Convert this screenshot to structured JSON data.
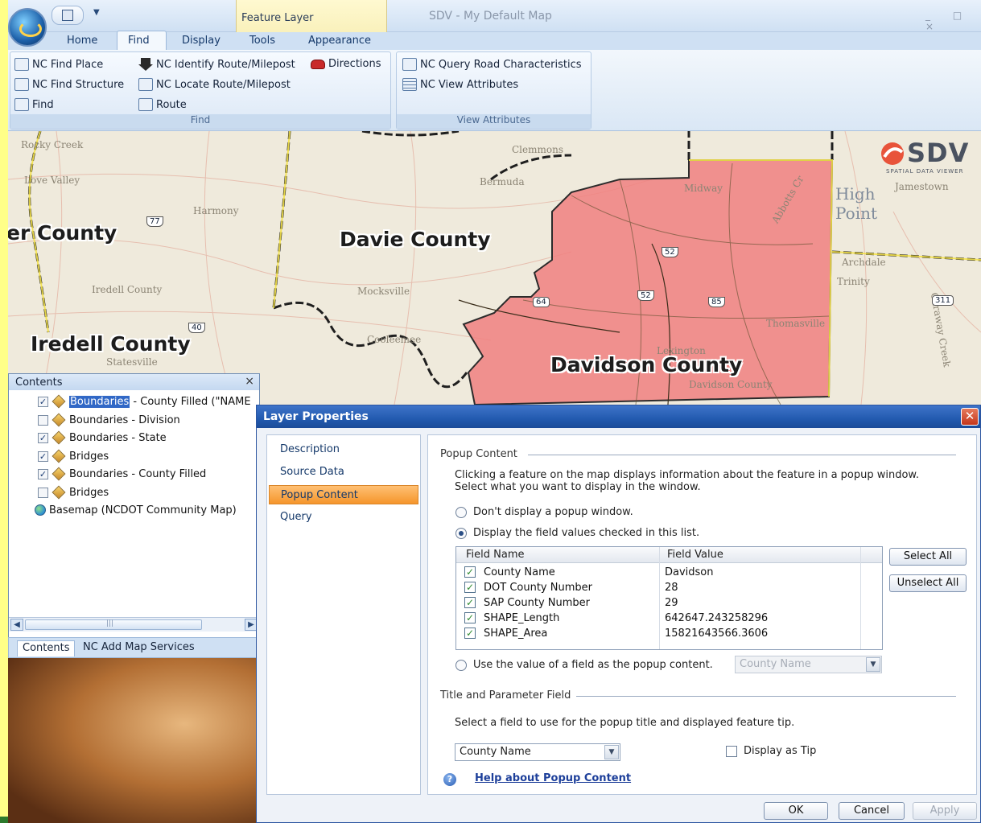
{
  "window": {
    "title": "SDV - My Default Map",
    "contextual_tab_group": "Feature Layer",
    "controls": "_ □ ×"
  },
  "ribbon": {
    "tabs": [
      "Home",
      "Find",
      "Display",
      "Tools",
      "Appearance"
    ],
    "active_tab": "Find",
    "groups": [
      {
        "label": "Find",
        "buttons": [
          {
            "label": "NC Find Place",
            "icon": "place-icon"
          },
          {
            "label": "NC Find Structure",
            "icon": "structure-icon"
          },
          {
            "label": "Find",
            "icon": "binoculars-icon"
          },
          {
            "label": "NC Identify Route/Milepost",
            "icon": "down-arrow-icon"
          },
          {
            "label": "NC Locate Route/Milepost",
            "icon": "locate-icon"
          },
          {
            "label": "Route",
            "icon": "route-icon"
          },
          {
            "label": "Directions",
            "icon": "car-icon"
          }
        ]
      },
      {
        "label": "View Attributes",
        "buttons": [
          {
            "label": "NC Query Road Characteristics",
            "icon": "query-icon"
          },
          {
            "label": "NC View Attributes",
            "icon": "table-icon"
          }
        ]
      }
    ]
  },
  "map": {
    "county_labels": [
      "er County",
      "Davie County",
      "Iredell County",
      "Davidson County"
    ],
    "towns": [
      "Rocky Creek",
      "Love Valley",
      "Harmony",
      "Clemmons",
      "Bermuda",
      "Midway",
      "Mocksville",
      "Iredell County",
      "Statesville",
      "Cooleemee",
      "Lexington",
      "Davidson County",
      "Thomasville",
      "Archdale",
      "Trinity",
      "Jamestown",
      "Caraway Creek",
      "Abbotts Cr"
    ],
    "high_point": "High Point",
    "route_shields": [
      "77",
      "52",
      "52",
      "85",
      "311",
      "40",
      "64"
    ],
    "logo_text": "SDV",
    "logo_subtext": "SPATIAL DATA VIEWER",
    "highlight_color": "#f08080"
  },
  "contents": {
    "title": "Contents",
    "close": "×",
    "layers": [
      {
        "label": "Boundaries - County Filled (\"NAME",
        "checked": true,
        "selected": true,
        "selected_part": "Boundaries",
        "rest": " - County Filled (\"NAME",
        "icon": "layer-icon"
      },
      {
        "label": "Boundaries - Division",
        "checked": false,
        "icon": "layer-icon"
      },
      {
        "label": "Boundaries - State",
        "checked": true,
        "icon": "layer-icon"
      },
      {
        "label": "Bridges",
        "checked": true,
        "icon": "layer-icon"
      },
      {
        "label": "Boundaries - County Filled",
        "checked": true,
        "icon": "layer-icon"
      },
      {
        "label": "Bridges",
        "checked": false,
        "icon": "layer-icon"
      },
      {
        "label": "Basemap (NCDOT Community Map)",
        "icon": "globe-icon"
      }
    ],
    "bottom_tabs": [
      "Contents",
      "NC Add Map Services"
    ],
    "scroll_thumb_grip": "|||"
  },
  "dialog": {
    "title": "Layer Properties",
    "nav": [
      "Description",
      "Source Data",
      "Popup Content",
      "Query"
    ],
    "active_nav": "Popup Content",
    "popup_section": "Popup Content",
    "popup_desc_line1": "Clicking  a feature on the map displays information about the feature in a popup window.",
    "popup_desc_line2": "Select what you want to display in the window.",
    "radio_none": "Don't display a popup window.",
    "radio_fields": "Display the field values checked in this list.",
    "radio_field_value": "Use the value of a field as the popup content.",
    "selected_radio": "fields",
    "grid_headers": [
      "Field Name",
      "Field Value"
    ],
    "fields": [
      {
        "name": "County Name",
        "value": "Davidson",
        "checked": true
      },
      {
        "name": "DOT County Number",
        "value": "28",
        "checked": true
      },
      {
        "name": "SAP County Number",
        "value": "29",
        "checked": true
      },
      {
        "name": "SHAPE_Length",
        "value": "642647.243258296",
        "checked": true
      },
      {
        "name": "SHAPE_Area",
        "value": "15821643566.3606",
        "checked": true
      }
    ],
    "select_all": "Select All",
    "unselect_all": "Unselect All",
    "popup_field_combo": "County Name",
    "title_section": "Title and Parameter Field",
    "title_desc": "Select a field to use for the popup title and displayed feature tip.",
    "title_field_combo": "County Name",
    "display_as_tip": "Display as Tip",
    "display_as_tip_checked": false,
    "help_link": "Help about Popup Content",
    "ok": "OK",
    "cancel": "Cancel",
    "apply": "Apply"
  }
}
